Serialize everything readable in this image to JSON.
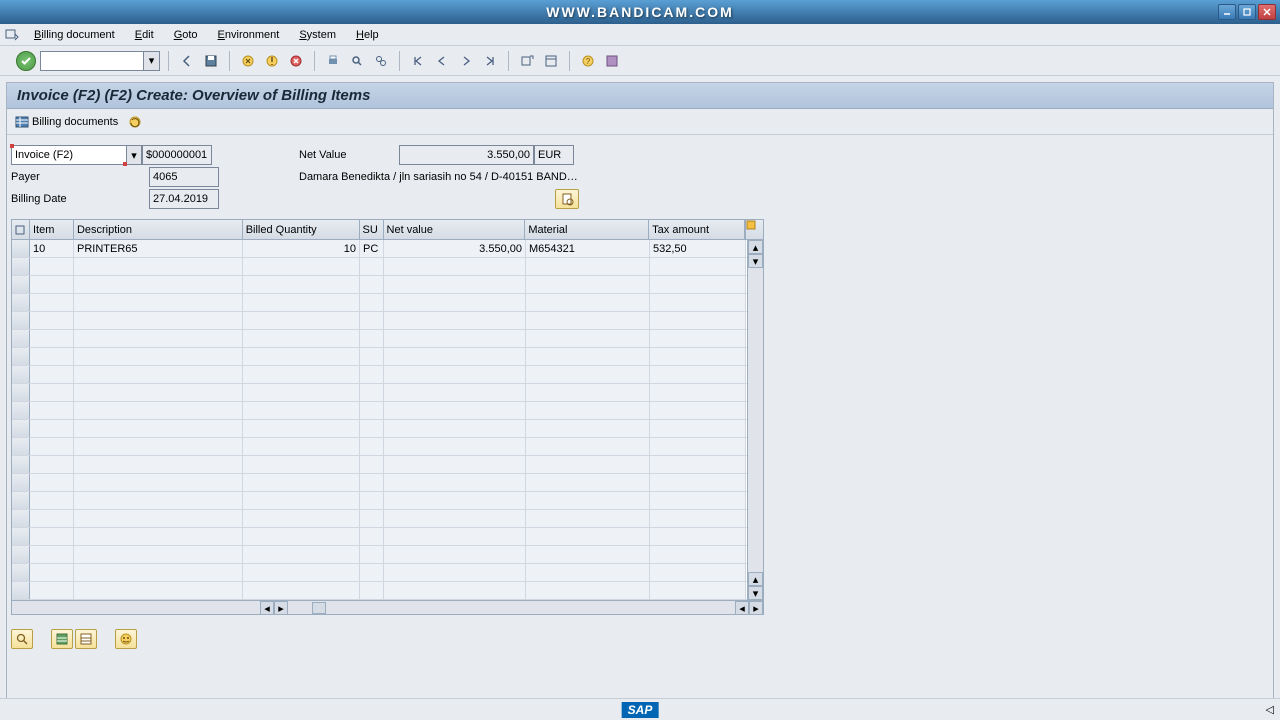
{
  "watermark": "WWW.BANDICAM.COM",
  "menu": [
    "Billing document",
    "Edit",
    "Goto",
    "Environment",
    "System",
    "Help"
  ],
  "screen_title": "Invoice (F2)  (F2) Create: Overview of Billing Items",
  "app_toolbar": {
    "billing_docs": "Billing documents"
  },
  "header": {
    "doc_type": "Invoice (F2)",
    "doc_number": "$000000001",
    "payer_label": "Payer",
    "payer": "4065",
    "date_label": "Billing Date",
    "date": "27.04.2019",
    "netvalue_label": "Net Value",
    "netvalue": "3.550,00",
    "currency": "EUR",
    "payer_addr": "Damara Benedikta / jln sariasih no 54 / D-40151 BAND…"
  },
  "table": {
    "columns": [
      "Item",
      "Description",
      "Billed Quantity",
      "SU",
      "Net value",
      "Material",
      "Tax amount"
    ],
    "rows": [
      {
        "item": "10",
        "desc": "PRINTER65",
        "qty": "10",
        "su": "PC",
        "net": "3.550,00",
        "mat": "M654321",
        "tax": "532,50"
      }
    ]
  },
  "sap": "SAP"
}
